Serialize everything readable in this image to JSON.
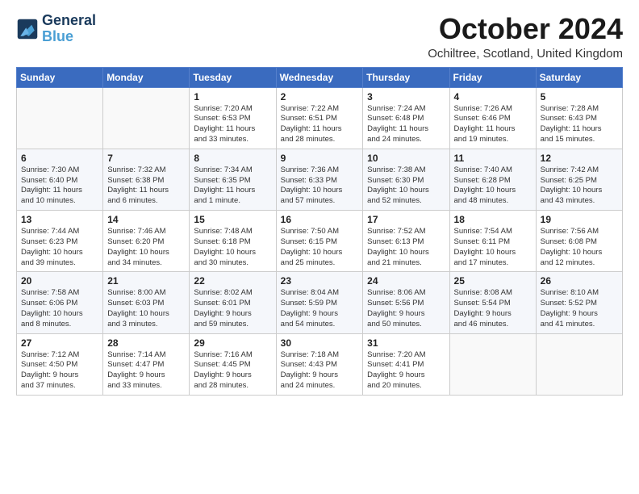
{
  "header": {
    "logo_line1": "General",
    "logo_line2": "Blue",
    "month": "October 2024",
    "location": "Ochiltree, Scotland, United Kingdom"
  },
  "weekdays": [
    "Sunday",
    "Monday",
    "Tuesday",
    "Wednesday",
    "Thursday",
    "Friday",
    "Saturday"
  ],
  "weeks": [
    [
      {
        "day": "",
        "info": ""
      },
      {
        "day": "",
        "info": ""
      },
      {
        "day": "1",
        "info": "Sunrise: 7:20 AM\nSunset: 6:53 PM\nDaylight: 11 hours\nand 33 minutes."
      },
      {
        "day": "2",
        "info": "Sunrise: 7:22 AM\nSunset: 6:51 PM\nDaylight: 11 hours\nand 28 minutes."
      },
      {
        "day": "3",
        "info": "Sunrise: 7:24 AM\nSunset: 6:48 PM\nDaylight: 11 hours\nand 24 minutes."
      },
      {
        "day": "4",
        "info": "Sunrise: 7:26 AM\nSunset: 6:46 PM\nDaylight: 11 hours\nand 19 minutes."
      },
      {
        "day": "5",
        "info": "Sunrise: 7:28 AM\nSunset: 6:43 PM\nDaylight: 11 hours\nand 15 minutes."
      }
    ],
    [
      {
        "day": "6",
        "info": "Sunrise: 7:30 AM\nSunset: 6:40 PM\nDaylight: 11 hours\nand 10 minutes."
      },
      {
        "day": "7",
        "info": "Sunrise: 7:32 AM\nSunset: 6:38 PM\nDaylight: 11 hours\nand 6 minutes."
      },
      {
        "day": "8",
        "info": "Sunrise: 7:34 AM\nSunset: 6:35 PM\nDaylight: 11 hours\nand 1 minute."
      },
      {
        "day": "9",
        "info": "Sunrise: 7:36 AM\nSunset: 6:33 PM\nDaylight: 10 hours\nand 57 minutes."
      },
      {
        "day": "10",
        "info": "Sunrise: 7:38 AM\nSunset: 6:30 PM\nDaylight: 10 hours\nand 52 minutes."
      },
      {
        "day": "11",
        "info": "Sunrise: 7:40 AM\nSunset: 6:28 PM\nDaylight: 10 hours\nand 48 minutes."
      },
      {
        "day": "12",
        "info": "Sunrise: 7:42 AM\nSunset: 6:25 PM\nDaylight: 10 hours\nand 43 minutes."
      }
    ],
    [
      {
        "day": "13",
        "info": "Sunrise: 7:44 AM\nSunset: 6:23 PM\nDaylight: 10 hours\nand 39 minutes."
      },
      {
        "day": "14",
        "info": "Sunrise: 7:46 AM\nSunset: 6:20 PM\nDaylight: 10 hours\nand 34 minutes."
      },
      {
        "day": "15",
        "info": "Sunrise: 7:48 AM\nSunset: 6:18 PM\nDaylight: 10 hours\nand 30 minutes."
      },
      {
        "day": "16",
        "info": "Sunrise: 7:50 AM\nSunset: 6:15 PM\nDaylight: 10 hours\nand 25 minutes."
      },
      {
        "day": "17",
        "info": "Sunrise: 7:52 AM\nSunset: 6:13 PM\nDaylight: 10 hours\nand 21 minutes."
      },
      {
        "day": "18",
        "info": "Sunrise: 7:54 AM\nSunset: 6:11 PM\nDaylight: 10 hours\nand 17 minutes."
      },
      {
        "day": "19",
        "info": "Sunrise: 7:56 AM\nSunset: 6:08 PM\nDaylight: 10 hours\nand 12 minutes."
      }
    ],
    [
      {
        "day": "20",
        "info": "Sunrise: 7:58 AM\nSunset: 6:06 PM\nDaylight: 10 hours\nand 8 minutes."
      },
      {
        "day": "21",
        "info": "Sunrise: 8:00 AM\nSunset: 6:03 PM\nDaylight: 10 hours\nand 3 minutes."
      },
      {
        "day": "22",
        "info": "Sunrise: 8:02 AM\nSunset: 6:01 PM\nDaylight: 9 hours\nand 59 minutes."
      },
      {
        "day": "23",
        "info": "Sunrise: 8:04 AM\nSunset: 5:59 PM\nDaylight: 9 hours\nand 54 minutes."
      },
      {
        "day": "24",
        "info": "Sunrise: 8:06 AM\nSunset: 5:56 PM\nDaylight: 9 hours\nand 50 minutes."
      },
      {
        "day": "25",
        "info": "Sunrise: 8:08 AM\nSunset: 5:54 PM\nDaylight: 9 hours\nand 46 minutes."
      },
      {
        "day": "26",
        "info": "Sunrise: 8:10 AM\nSunset: 5:52 PM\nDaylight: 9 hours\nand 41 minutes."
      }
    ],
    [
      {
        "day": "27",
        "info": "Sunrise: 7:12 AM\nSunset: 4:50 PM\nDaylight: 9 hours\nand 37 minutes."
      },
      {
        "day": "28",
        "info": "Sunrise: 7:14 AM\nSunset: 4:47 PM\nDaylight: 9 hours\nand 33 minutes."
      },
      {
        "day": "29",
        "info": "Sunrise: 7:16 AM\nSunset: 4:45 PM\nDaylight: 9 hours\nand 28 minutes."
      },
      {
        "day": "30",
        "info": "Sunrise: 7:18 AM\nSunset: 4:43 PM\nDaylight: 9 hours\nand 24 minutes."
      },
      {
        "day": "31",
        "info": "Sunrise: 7:20 AM\nSunset: 4:41 PM\nDaylight: 9 hours\nand 20 minutes."
      },
      {
        "day": "",
        "info": ""
      },
      {
        "day": "",
        "info": ""
      }
    ]
  ]
}
